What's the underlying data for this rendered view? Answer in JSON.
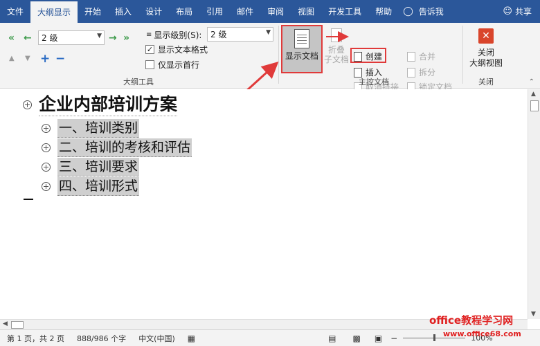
{
  "tabs": [
    "文件",
    "大纲显示",
    "开始",
    "插入",
    "设计",
    "布局",
    "引用",
    "邮件",
    "审阅",
    "视图",
    "开发工具",
    "帮助"
  ],
  "tell_me": "告诉我",
  "share": "共享",
  "outline_tools": {
    "level_value": "2 级",
    "show_level_label": "显示级别(S):",
    "show_level_value": "2 级",
    "show_text_format_label": "显示文本格式",
    "show_text_format_checked": true,
    "show_first_line_label": "仅显示首行",
    "show_first_line_checked": false,
    "group_label": "大纲工具"
  },
  "master_document": {
    "show_document": "显示文档",
    "collapse_line1": "折叠",
    "collapse_line2": "子文档",
    "create": "创建",
    "insert": "插入",
    "unlink": "取消链接",
    "merge": "合并",
    "split": "拆分",
    "lock": "锁定文档",
    "group_label": "主控文档"
  },
  "close_group": {
    "close_line1": "关闭",
    "close_line2": "大纲视图",
    "group_label": "关闭"
  },
  "document": {
    "title": "企业内部培训方案",
    "items": [
      "一、培训类别",
      "二、培训的考核和评估",
      "三、培训要求",
      "四、培训形式"
    ]
  },
  "status_bar": {
    "page": "第 1 页，共 2 页",
    "words": "888/986 个字",
    "language": "中文(中国)",
    "zoom": "100%"
  },
  "watermark": {
    "line1": "office教程学习网",
    "line2": "www.office68.com"
  },
  "colors": {
    "tab_bar": "#2b579a",
    "highlight_box": "#e03a3a",
    "close_icon": "#d9452b"
  }
}
